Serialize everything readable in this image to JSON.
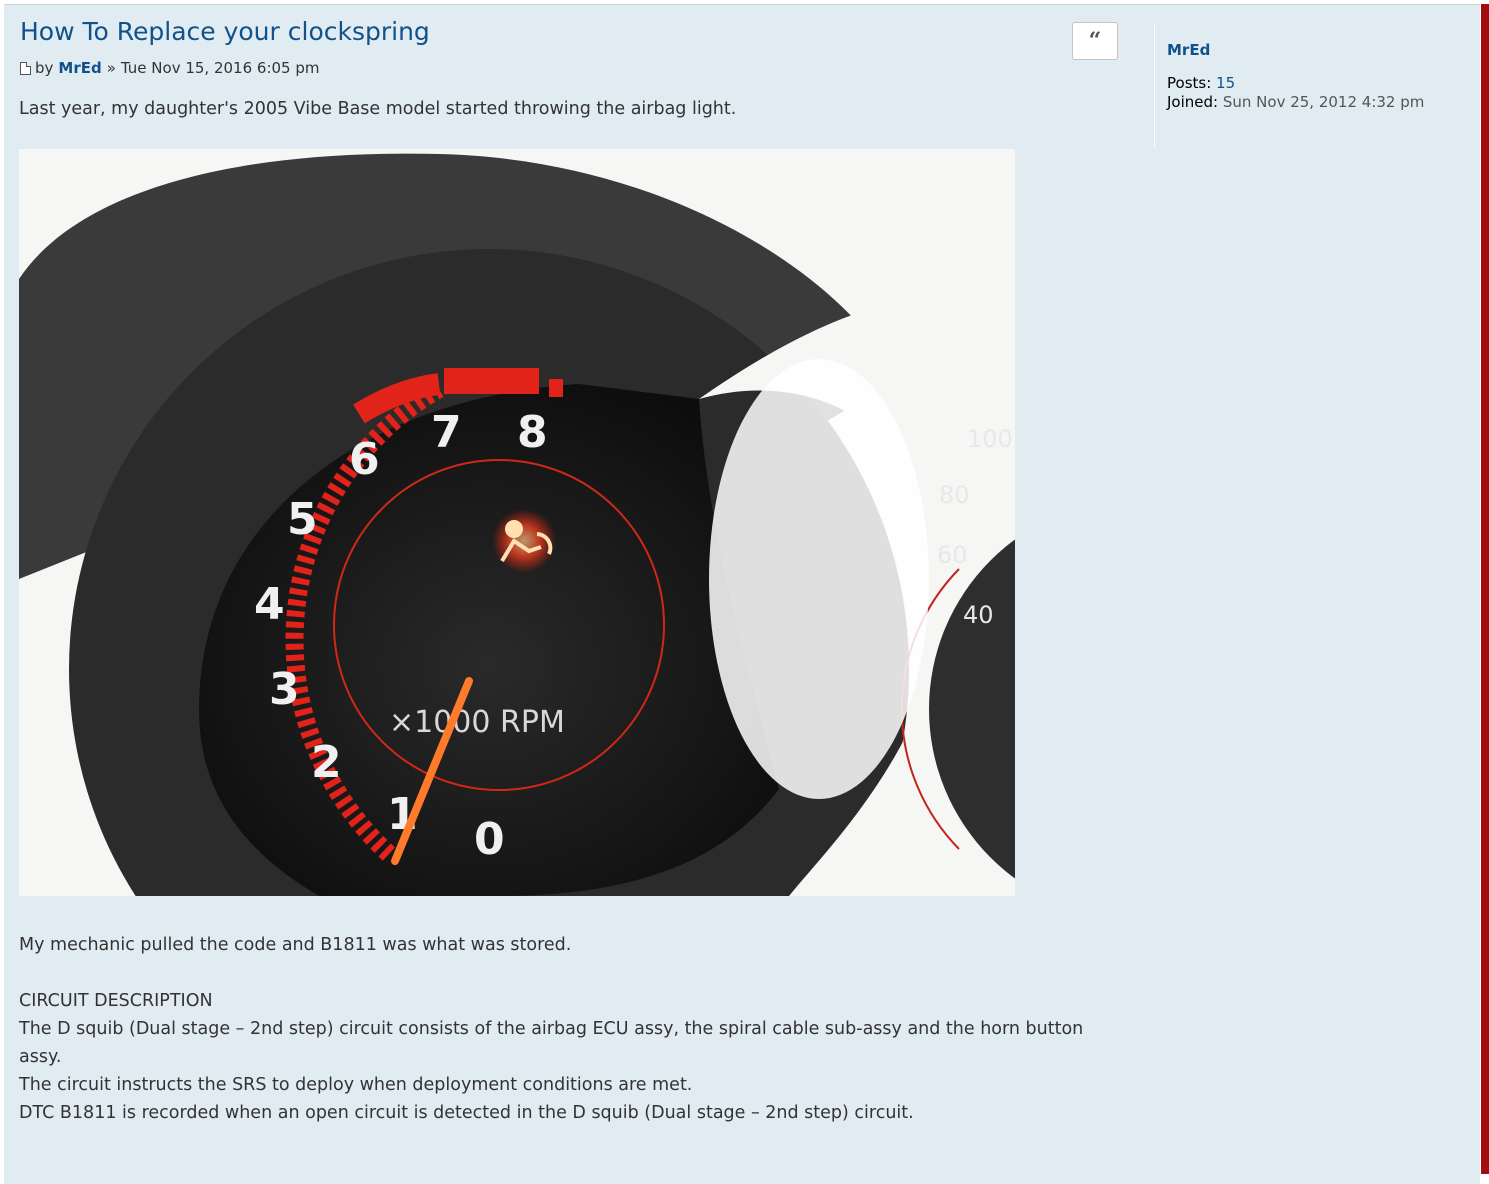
{
  "post": {
    "title": "How To Replace your clockspring",
    "meta": {
      "by_label": "by",
      "author": "MrEd",
      "separator": "»",
      "date": "Tue Nov 15, 2016 6:05 pm"
    },
    "quote_button_glyph": "“",
    "intro": "Last year, my daughter's 2005 Vibe Base model started throwing the airbag light.",
    "image": {
      "tach_numbers": [
        "0",
        "1",
        "2",
        "3",
        "4",
        "5",
        "6",
        "7",
        "8"
      ],
      "tach_unit": "×1000 RPM",
      "speedo_numbers": [
        "100",
        "80",
        "60",
        "40"
      ]
    },
    "paragraphs": [
      "My mechanic pulled the code and B1811 was what was stored.",
      "",
      "CIRCUIT DESCRIPTION",
      "The D squib (Dual stage – 2nd step) circuit consists of the airbag ECU assy, the spiral cable sub-assy and the horn button assy.",
      "The circuit instructs the SRS to deploy when deployment conditions are met.",
      "DTC B1811 is recorded when an open circuit is detected in the D squib (Dual stage – 2nd step) circuit."
    ]
  },
  "profile": {
    "username": "MrEd",
    "posts_label": "Posts:",
    "posts_value": "15",
    "joined_label": "Joined:",
    "joined_value": "Sun Nov 25, 2012 4:32 pm"
  },
  "colors": {
    "post_bg": "#e1ebf2",
    "link_blue": "#105289",
    "text": "#333333",
    "edge_red": "#a30d0d"
  }
}
